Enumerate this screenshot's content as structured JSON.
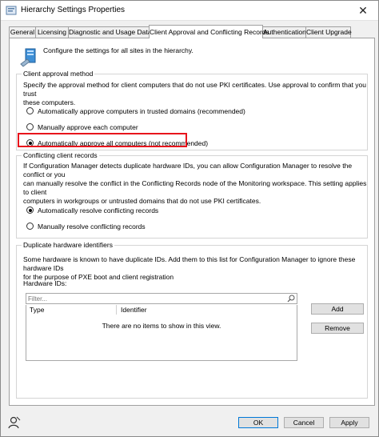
{
  "window": {
    "title": "Hierarchy Settings Properties"
  },
  "tabs": [
    {
      "label": "General"
    },
    {
      "label": "Licensing"
    },
    {
      "label": "Diagnostic and Usage Data"
    },
    {
      "label": "Client Approval and Conflicting Records",
      "active": true
    },
    {
      "label": "Authentication"
    },
    {
      "label": "Client Upgrade"
    }
  ],
  "intro": "Configure the settings for all sites in the hierarchy.",
  "approval": {
    "title": "Client approval method",
    "desc_line1": "Specify the approval method for client computers that do not use PKI certificates. Use approval to confirm that you trust",
    "desc_line2": "these computers.",
    "options": [
      {
        "label": "Automatically approve computers in trusted domains (recommended)",
        "selected": false
      },
      {
        "label": "Manually approve each computer",
        "selected": false
      },
      {
        "label": "Automatically approve all computers (not recommended)",
        "selected": true
      }
    ]
  },
  "conflicts": {
    "title": "Conflicting client records",
    "desc_line1": "If Configuration Manager detects duplicate hardware IDs, you can allow Configuration Manager to resolve the conflict or you",
    "desc_line2": "can manually resolve the conflict in the Conflicting Records node of the Monitoring workspace. This setting applies to client",
    "desc_line3": "computers in workgroups or untrusted domains that do not use PKI certificates.",
    "options": [
      {
        "label": "Automatically resolve conflicting records",
        "selected": true
      },
      {
        "label": "Manually resolve conflicting records",
        "selected": false
      }
    ]
  },
  "duplicates": {
    "title": "Duplicate hardware identifiers",
    "desc_line1": "Some hardware is known to have duplicate IDs. Add them to this list for Configuration Manager to ignore these hardware IDs",
    "desc_line2": "for the purpose of PXE boot and client registration",
    "hardware_ids_label": "Hardware IDs:",
    "filter_placeholder": "Filter...",
    "columns": [
      "Type",
      "Identifier"
    ],
    "empty_message": "There are no items to show in this view.",
    "add_label": "Add",
    "remove_label": "Remove"
  },
  "footer": {
    "ok_label": "OK",
    "cancel_label": "Cancel",
    "apply_label": "Apply"
  },
  "colors": {
    "highlight": "#e8141c",
    "accent": "#0078d7"
  }
}
